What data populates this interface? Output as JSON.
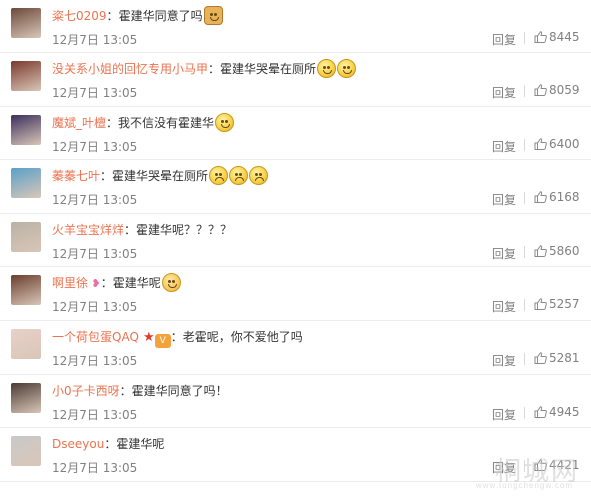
{
  "comments": [
    {
      "user": "粢七0209",
      "text": "霍建华同意了吗",
      "emojis": [
        "doge-emoji"
      ],
      "time": "12月7日 13:05",
      "reply": "回复",
      "likes": "8445",
      "avatar_color": "#6b4a3a"
    },
    {
      "user": "没关系小姐的回忆专用小马甲",
      "text": "霍建华哭晕在厕所",
      "emojis": [
        "smile-emoji",
        "smile-emoji"
      ],
      "time": "12月7日 13:05",
      "reply": "回复",
      "likes": "8059",
      "avatar_color": "#7a3a2e"
    },
    {
      "user": "魔斌_叶檀",
      "text": "我不信没有霍建华",
      "emojis": [
        "shocked-emoji"
      ],
      "time": "12月7日 13:05",
      "reply": "回复",
      "likes": "6400",
      "avatar_color": "#3b2f5c"
    },
    {
      "user": "蓁蓁七叶",
      "text": "霍建华哭晕在厕所",
      "emojis": [
        "sad-emoji",
        "sad-emoji",
        "sad-emoji"
      ],
      "time": "12月7日 13:05",
      "reply": "回复",
      "likes": "6168",
      "avatar_color": "#5aa0c8"
    },
    {
      "user": "火羊宝宝烊烊",
      "text": "霍建华呢？？？？",
      "emojis": [],
      "time": "12月7日 13:05",
      "reply": "回复",
      "likes": "5860",
      "avatar_color": "#b9b2a5"
    },
    {
      "user": "啊里徐",
      "text": "霍建华呢",
      "emojis": [
        "angry-emoji"
      ],
      "time": "12月7日 13:05",
      "reply": "回复",
      "likes": "5257",
      "avatar_color": "#6a3e2c",
      "badge": "butterfly"
    },
    {
      "user": "一个荷包蛋QAQ",
      "text": "老霍呢，你不爱他了吗",
      "emojis": [],
      "time": "12月7日 13:05",
      "reply": "回复",
      "likes": "5281",
      "avatar_color": "#e8d0c8",
      "badge": "star-vip"
    },
    {
      "user": "小0子卡西呀",
      "text": "霍建华同意了吗！",
      "emojis": [],
      "time": "12月7日 13:05",
      "reply": "回复",
      "likes": "4945",
      "avatar_color": "#4a3a32"
    },
    {
      "user": "Dseeyou",
      "text": "霍建华呢",
      "emojis": [],
      "time": "12月7日 13:05",
      "reply": "回复",
      "likes": "4421",
      "avatar_color": "#c9c9c9"
    }
  ],
  "colon": "：",
  "vip_label": "V",
  "watermark": {
    "main": "桐城网",
    "sub": "www.tongchengw.com"
  }
}
